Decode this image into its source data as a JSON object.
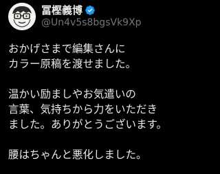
{
  "author": {
    "display_name": "冨樫義博",
    "handle": "@Un4v5s8bgsVk9Xp",
    "verified": true,
    "avatar_icon": "cartoon-face-avatar"
  },
  "tweet": {
    "paragraphs": [
      [
        "おかげさまで編集さんに",
        "カラー原稿を渡せました。"
      ],
      [
        "温かい励ましやお気遣いの",
        "言葉、気持ちから力をいただき",
        "ました。ありがとうございます。"
      ],
      [
        "腰はちゃんと悪化しました。"
      ]
    ]
  },
  "colors": {
    "background": "#000000",
    "text": "#e7e9ea",
    "muted": "#71767b",
    "verified_badge": "#1d9bf0"
  }
}
